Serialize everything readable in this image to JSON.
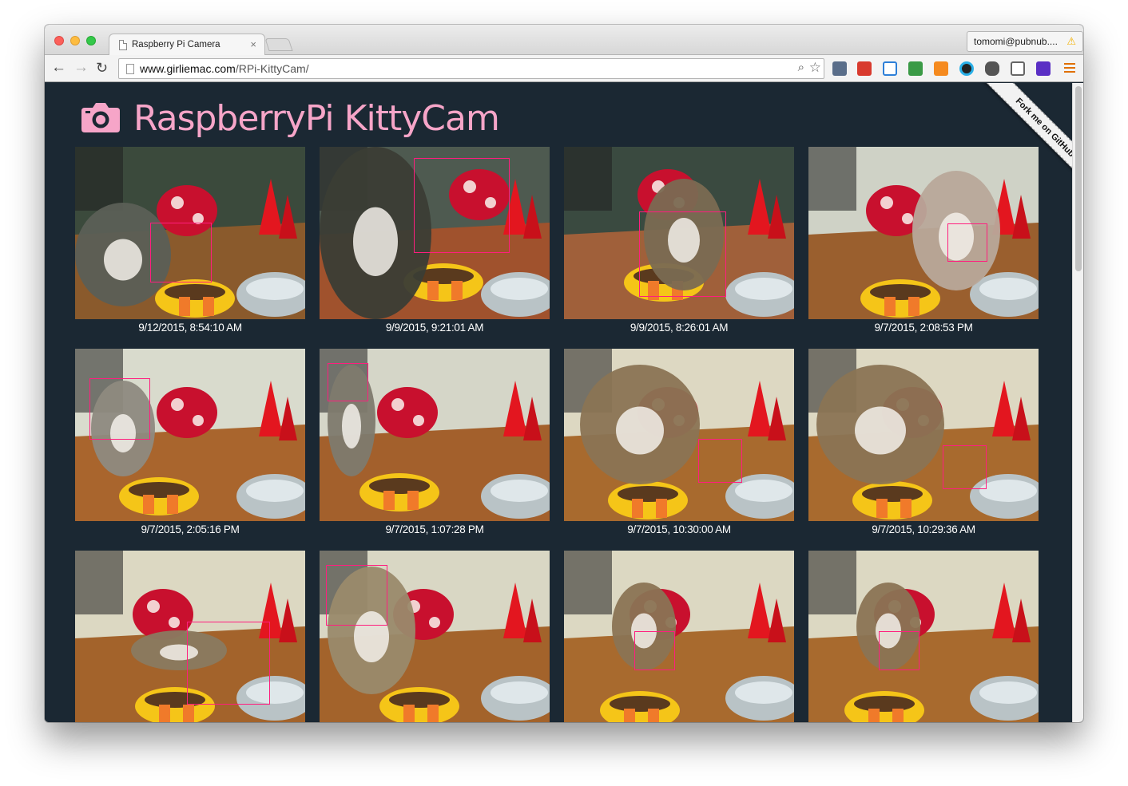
{
  "browser": {
    "tab_title": "Raspberry Pi Camera",
    "tab_close": "×",
    "profile_name": "tomomi@pubnub....",
    "warning_glyph": "⚠",
    "url_host": "www.girliemac.com",
    "url_path": "/RPi-KittyCam/",
    "back_glyph": "←",
    "forward_glyph": "→",
    "reload_glyph": "↻",
    "zoom_glyph": "⌕",
    "star_glyph": "☆"
  },
  "site": {
    "title": "RaspberryPi KittyCam",
    "ribbon": "Fork me on GitHub",
    "title_color": "#f6a5c8",
    "background_color": "#1b2833",
    "detection_color": "#ff1e7e"
  },
  "photos": [
    {
      "timestamp": "9/12/2015, 8:54:10 AM"
    },
    {
      "timestamp": "9/9/2015, 9:21:01 AM"
    },
    {
      "timestamp": "9/9/2015, 8:26:01 AM"
    },
    {
      "timestamp": "9/7/2015, 2:08:53 PM"
    },
    {
      "timestamp": "9/7/2015, 2:05:16 PM"
    },
    {
      "timestamp": "9/7/2015, 1:07:28 PM"
    },
    {
      "timestamp": "9/7/2015, 10:30:00 AM"
    },
    {
      "timestamp": "9/7/2015, 10:29:36 AM"
    },
    {
      "timestamp": ""
    },
    {
      "timestamp": ""
    },
    {
      "timestamp": ""
    },
    {
      "timestamp": ""
    }
  ]
}
